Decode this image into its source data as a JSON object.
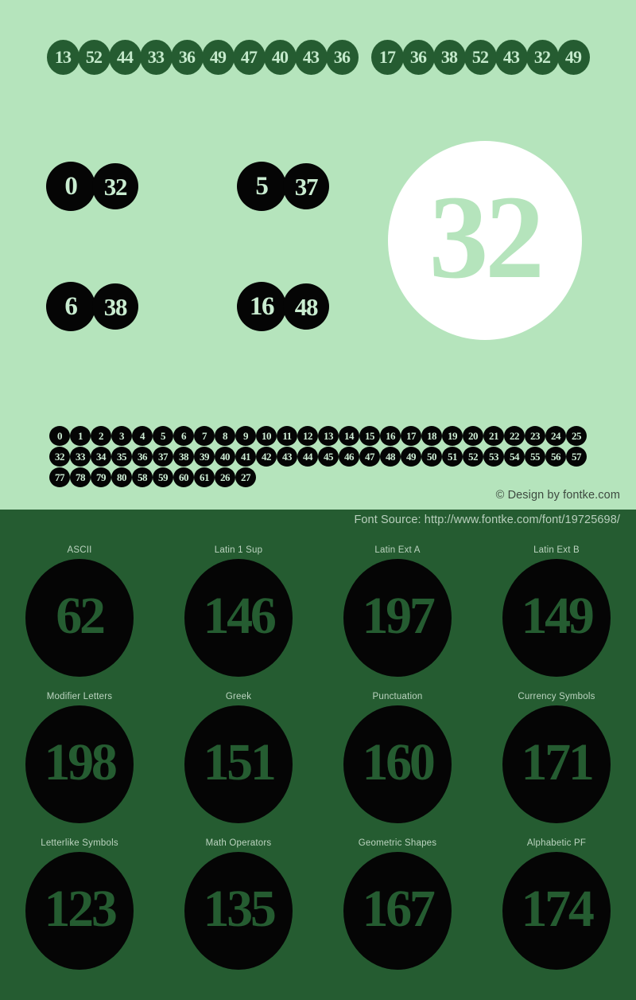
{
  "colors": {
    "light_background": "#b5e4bc",
    "dark_background": "#255c31",
    "glyph_black": "#050505",
    "glyph_light": "#c9ecd0",
    "showcase_circle": "#ffffff"
  },
  "headline": {
    "groups": [
      [
        "13",
        "52",
        "44",
        "33",
        "36",
        "49",
        "47",
        "40",
        "43",
        "36"
      ],
      [
        "17",
        "36",
        "38",
        "52",
        "43",
        "32",
        "49"
      ]
    ]
  },
  "pairs": [
    {
      "name": "pair-top-left",
      "left": "0",
      "right": "32"
    },
    {
      "name": "pair-top-right",
      "left": "5",
      "right": "37"
    },
    {
      "name": "pair-bottom-left",
      "left": "6",
      "right": "38"
    },
    {
      "name": "pair-bottom-right",
      "left": "16",
      "right": "48"
    }
  ],
  "showcase": {
    "value": "32"
  },
  "charset": {
    "rows": [
      [
        "0",
        "1",
        "2",
        "3",
        "4",
        "5",
        "6",
        "7",
        "8",
        "9",
        "10",
        "11",
        "12",
        "13",
        "14",
        "15",
        "16",
        "17",
        "18",
        "19",
        "20",
        "21",
        "22",
        "23",
        "24",
        "25"
      ],
      [
        "32",
        "33",
        "34",
        "35",
        "36",
        "37",
        "38",
        "39",
        "40",
        "41",
        "42",
        "43",
        "44",
        "45",
        "46",
        "47",
        "48",
        "49",
        "50",
        "51",
        "52",
        "53",
        "54",
        "55",
        "56",
        "57"
      ],
      [
        "77",
        "78",
        "79",
        "80",
        "58",
        "59",
        "60",
        "61",
        "26",
        "27"
      ]
    ]
  },
  "credit": {
    "design": "© Design by fontke.com",
    "source": "Font Source: http://www.fontke.com/font/19725698/"
  },
  "blocks": {
    "rows": [
      [
        {
          "label": "ASCII",
          "value": "62"
        },
        {
          "label": "Latin 1 Sup",
          "value": "146"
        },
        {
          "label": "Latin Ext A",
          "value": "197"
        },
        {
          "label": "Latin Ext B",
          "value": "149"
        }
      ],
      [
        {
          "label": "Modifier Letters",
          "value": "198"
        },
        {
          "label": "Greek",
          "value": "151"
        },
        {
          "label": "Punctuation",
          "value": "160"
        },
        {
          "label": "Currency Symbols",
          "value": "171"
        }
      ],
      [
        {
          "label": "Letterlike Symbols",
          "value": "123"
        },
        {
          "label": "Math Operators",
          "value": "135"
        },
        {
          "label": "Geometric Shapes",
          "value": "167"
        },
        {
          "label": "Alphabetic PF",
          "value": "174"
        }
      ]
    ]
  }
}
